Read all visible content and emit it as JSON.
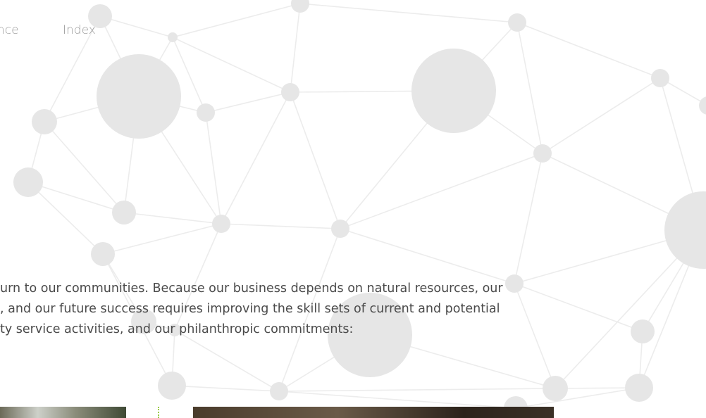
{
  "nav": {
    "items": [
      {
        "label": "nce"
      },
      {
        "label": "Index"
      }
    ]
  },
  "content": {
    "lines": [
      "urn to our communities. Because our business depends on natural resources, our",
      ", and our future success requires improving the skill sets of current and potential",
      "ty service activities, and our philanthropic commitments:"
    ]
  },
  "colors": {
    "background": "#ffffff",
    "network": "#ebebeb",
    "text": "#4a4a4a",
    "nav_text": "#9a9a9a",
    "accent": "#9ccb4a"
  }
}
